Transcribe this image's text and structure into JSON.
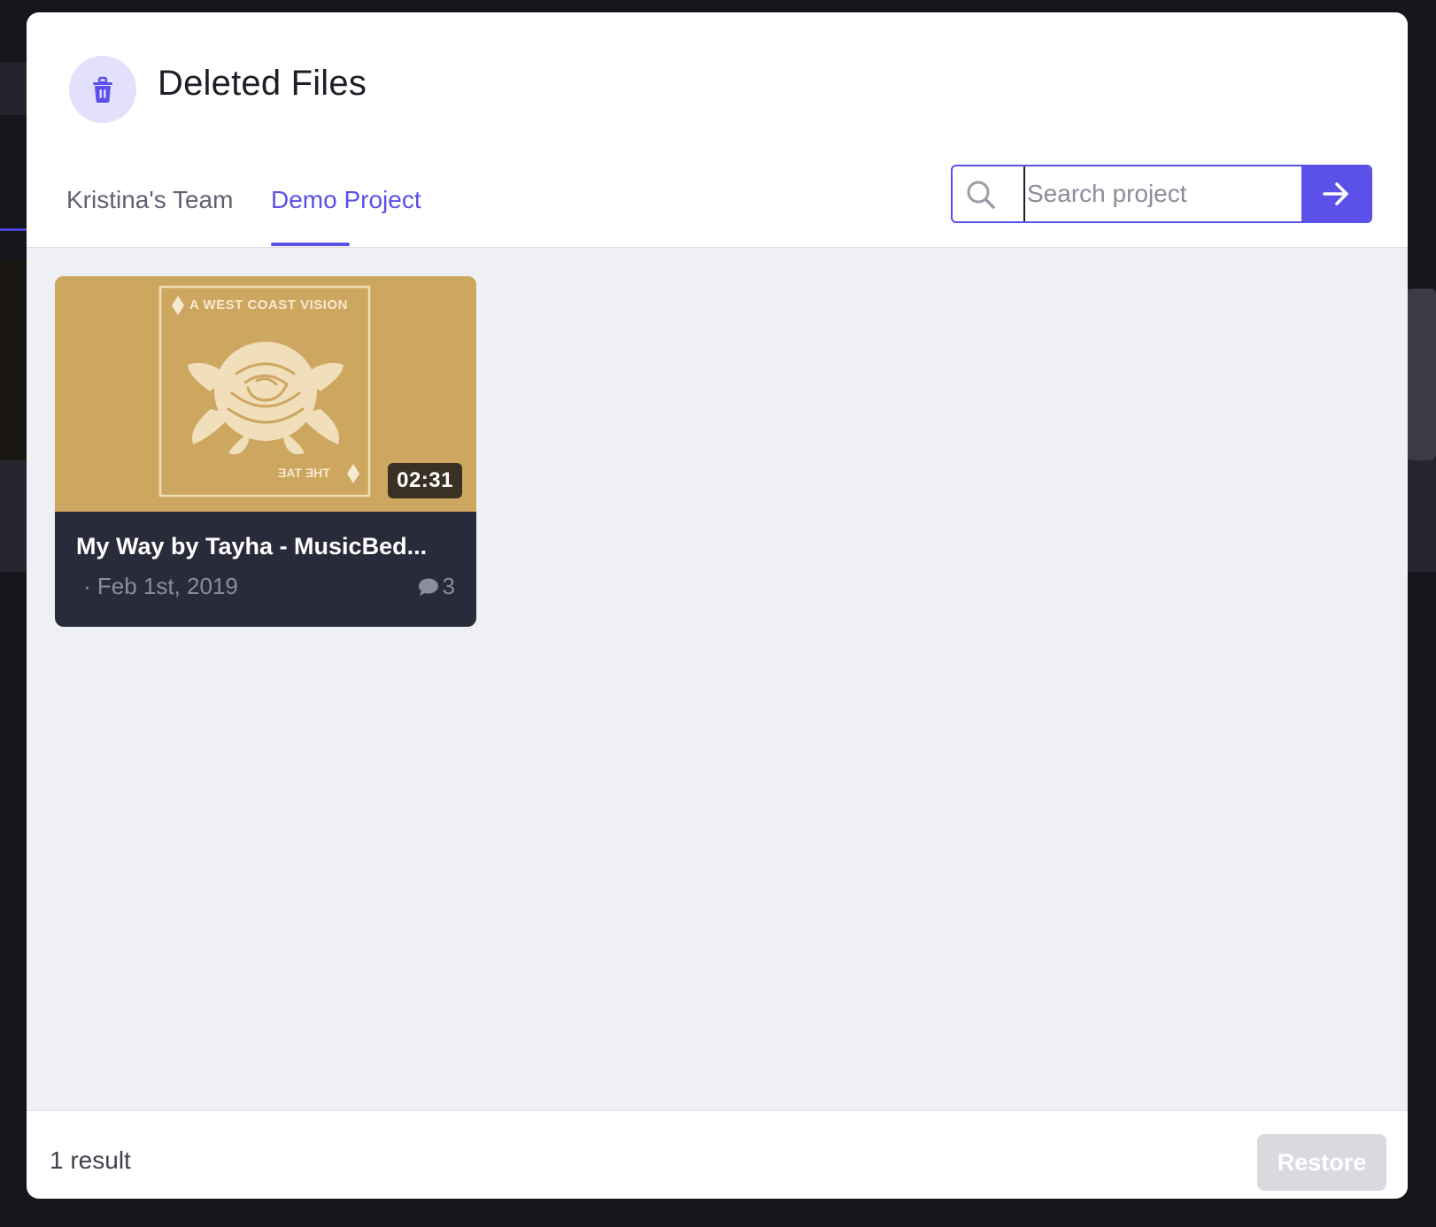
{
  "modal": {
    "title": "Deleted Files",
    "title_icon": "trash-icon"
  },
  "tabs": [
    {
      "label": "Kristina's Team",
      "active": false
    },
    {
      "label": "Demo Project",
      "active": true
    }
  ],
  "search": {
    "placeholder": "Search project",
    "value": "",
    "submit_icon": "arrow-right-icon",
    "icon": "search-icon"
  },
  "files": [
    {
      "title": "My Way by Tayha - MusicBed...",
      "duration": "02:31",
      "date": "· Feb 1st, 2019",
      "comment_count": "3",
      "comment_icon": "speech-bubble-icon",
      "thumbnail": {
        "background_color": "#cda65f",
        "top_text": "A WEST COAST VISION",
        "bottom_text": "THE TAE",
        "image": "rose illustration"
      }
    }
  ],
  "footer": {
    "result_count": "1 result",
    "restore_label": "Restore"
  },
  "colors": {
    "accent": "#5b50e8",
    "content_background": "#eff0f4",
    "card_background": "#2a2b3a",
    "restore_disabled": "#d8dae0"
  }
}
